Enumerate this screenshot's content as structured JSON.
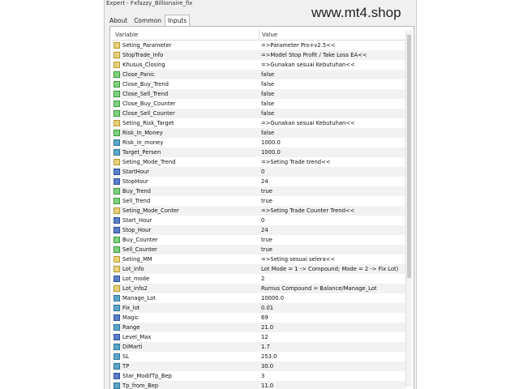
{
  "window_title": "Expert - Fxfazzy_Billionaire_fix",
  "watermark": "www.mt4.shop",
  "tabs": [
    "About",
    "Common",
    "Inputs"
  ],
  "active_tab": "Inputs",
  "columns": {
    "variable": "Variable",
    "value": "Value"
  },
  "rows": [
    {
      "name": "Seting_Parameter",
      "value": "=>Parameter Pro+v2.5<<",
      "icon": "text-param-icon",
      "type": "ab"
    },
    {
      "name": "StopTrade_Info",
      "value": "=>Model Stop Profit / Take Loss EA<<",
      "icon": "text-param-icon",
      "type": "ab"
    },
    {
      "name": "Khusus_Closing",
      "value": "=>Gunakan sesuai Kebutuhan<<",
      "icon": "text-param-icon",
      "type": "ab"
    },
    {
      "name": "Close_Panic",
      "value": "false",
      "icon": "bool-param-icon",
      "type": "bool"
    },
    {
      "name": "Close_Buy_Trend",
      "value": "false",
      "icon": "bool-param-icon",
      "type": "bool"
    },
    {
      "name": "Close_Sell_Trend",
      "value": "false",
      "icon": "bool-param-icon",
      "type": "bool"
    },
    {
      "name": "Close_Buy_Counter",
      "value": "false",
      "icon": "bool-param-icon",
      "type": "bool"
    },
    {
      "name": "Close_Sell_Counter",
      "value": "false",
      "icon": "bool-param-icon",
      "type": "bool"
    },
    {
      "name": "Seting_Risk_Target",
      "value": "=>Gunakan sesuai Kebutuhan<<",
      "icon": "text-param-icon",
      "type": "ab"
    },
    {
      "name": "Risk_In_Money",
      "value": "false",
      "icon": "bool-param-icon",
      "type": "bool"
    },
    {
      "name": "Risk_in_money",
      "value": "1000.0",
      "icon": "double-param-icon",
      "type": "dbl"
    },
    {
      "name": "Target_Persen",
      "value": "1000.0",
      "icon": "double-param-icon",
      "type": "dbl"
    },
    {
      "name": "Seting_Mode_Trend",
      "value": "=>Seting Trade trend<<",
      "icon": "text-param-icon",
      "type": "ab"
    },
    {
      "name": "StartHour",
      "value": "0",
      "icon": "int-param-icon",
      "type": "int"
    },
    {
      "name": "StopHour",
      "value": "24",
      "icon": "int-param-icon",
      "type": "int"
    },
    {
      "name": "Buy_Trend",
      "value": "true",
      "icon": "bool-param-icon",
      "type": "bool"
    },
    {
      "name": "Sell_Trend",
      "value": "true",
      "icon": "bool-param-icon",
      "type": "bool"
    },
    {
      "name": "Seting_Mode_Conter",
      "value": "=>Seting Trade Counter Trend<<",
      "icon": "text-param-icon",
      "type": "ab"
    },
    {
      "name": "Start_Hour",
      "value": "0",
      "icon": "int-param-icon",
      "type": "int"
    },
    {
      "name": "Stop_Hour",
      "value": "24",
      "icon": "int-param-icon",
      "type": "int"
    },
    {
      "name": "Buy_Counter",
      "value": "true",
      "icon": "bool-param-icon",
      "type": "bool"
    },
    {
      "name": "Sell_Counter",
      "value": "true",
      "icon": "bool-param-icon",
      "type": "bool"
    },
    {
      "name": "Seting_MM",
      "value": "=>Seting sesuai selera<<",
      "icon": "text-param-icon",
      "type": "ab"
    },
    {
      "name": "Lot_info",
      "value": "Lot Mode = 1 -> Compound; Mode = 2 -> Fix Lot)",
      "icon": "text-param-icon",
      "type": "ab"
    },
    {
      "name": "Lot_mode",
      "value": "2",
      "icon": "int-param-icon",
      "type": "int"
    },
    {
      "name": "Lot_info2",
      "value": "Rumus Compound = Balance/Manage_Lot",
      "icon": "text-param-icon",
      "type": "ab"
    },
    {
      "name": "Manage_Lot",
      "value": "10000.0",
      "icon": "double-param-icon",
      "type": "dbl"
    },
    {
      "name": "Fix_lot",
      "value": "0.01",
      "icon": "double-param-icon",
      "type": "dbl"
    },
    {
      "name": "Magic",
      "value": "69",
      "icon": "int-param-icon",
      "type": "int"
    },
    {
      "name": "Range",
      "value": "21.0",
      "icon": "double-param-icon",
      "type": "dbl"
    },
    {
      "name": "Level_Max",
      "value": "12",
      "icon": "int-param-icon",
      "type": "int"
    },
    {
      "name": "DiMarti",
      "value": "1.7",
      "icon": "double-param-icon",
      "type": "dbl"
    },
    {
      "name": "SL",
      "value": "253.0",
      "icon": "double-param-icon",
      "type": "dbl"
    },
    {
      "name": "TP",
      "value": "30.0",
      "icon": "double-param-icon",
      "type": "dbl"
    },
    {
      "name": "Star_ModifTp_Bep",
      "value": "3",
      "icon": "int-param-icon",
      "type": "int"
    },
    {
      "name": "Tp_from_Bep",
      "value": "11.0",
      "icon": "double-param-icon",
      "type": "dbl"
    }
  ]
}
